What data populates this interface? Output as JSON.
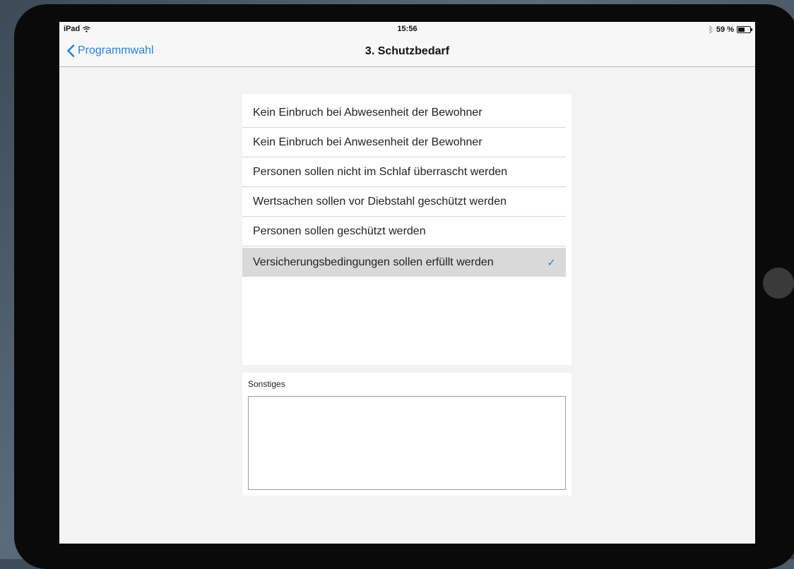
{
  "status_bar": {
    "device": "iPad",
    "time": "15:56",
    "battery": "59 %",
    "battery_level": 0.59
  },
  "nav": {
    "back_label": "Programmwahl",
    "title": "3. Schutzbedarf"
  },
  "options": [
    {
      "label": "Kein Einbruch bei Abwesenheit der Bewohner",
      "selected": false
    },
    {
      "label": "Kein Einbruch bei Anwesenheit der Bewohner",
      "selected": false
    },
    {
      "label": "Personen sollen nicht im Schlaf überrascht werden",
      "selected": false
    },
    {
      "label": "Wertsachen sollen vor Diebstahl geschützt werden",
      "selected": false
    },
    {
      "label": "Personen sollen geschützt werden",
      "selected": false
    },
    {
      "label": "Versicherungsbedingungen sollen erfüllt werden",
      "selected": true
    }
  ],
  "notes": {
    "label": "Sonstiges",
    "value": ""
  },
  "colors": {
    "accent": "#2b7fd8",
    "selected_row": "#d9d9d9"
  }
}
